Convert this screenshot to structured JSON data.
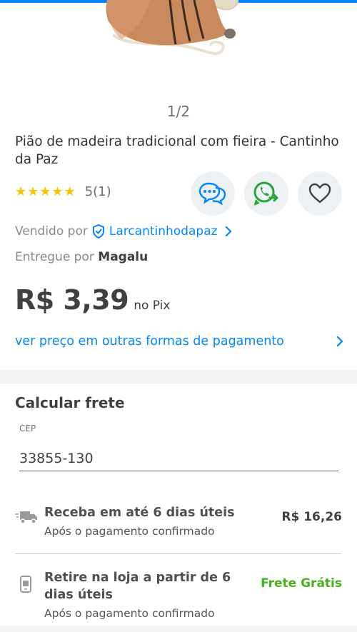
{
  "gallery": {
    "counter": "1/2"
  },
  "product": {
    "title": "Pião de madeira tradicional com fieira - Cantinho da Paz",
    "rating_text": "5(1)",
    "stars": 5
  },
  "actions": {
    "chat_icon": "chat-bubble-icon",
    "whatsapp_icon": "whatsapp-share-icon",
    "favorite_icon": "heart-icon"
  },
  "seller": {
    "prefix": "Vendido por",
    "name": "Larcantinhodapaz",
    "verified_icon": "shield-check-icon"
  },
  "delivery": {
    "prefix": "Entregue por",
    "carrier": "Magalu"
  },
  "price": {
    "value": "R$ 3,39",
    "suffix": "no Pix"
  },
  "payment_link": "ver preço em outras formas de pagamento",
  "shipping": {
    "title": "Calcular frete",
    "cep_label": "CEP",
    "cep_value": "33855-130",
    "options": [
      {
        "icon": "truck-icon",
        "title": "Receba em até 6 dias úteis",
        "subtitle": "Após o pagamento confirmado",
        "price": "R$ 16,26"
      },
      {
        "icon": "store-pickup-icon",
        "title_line1": "Retire na loja a partir de 6",
        "title_line2": "dias úteis",
        "subtitle": "Após o pagamento confirmado",
        "price": "Frete Grátis"
      }
    ]
  },
  "colors": {
    "accent": "#0086ff",
    "star": "#f5c400",
    "free_shipping": "#46b01a",
    "whatsapp": "#25a53a"
  }
}
